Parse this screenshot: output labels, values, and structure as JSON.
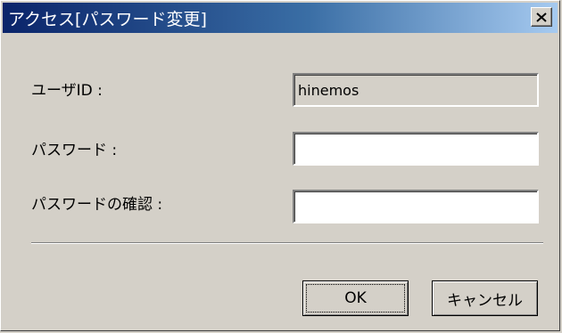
{
  "window": {
    "title": "アクセス[パスワード変更]",
    "close_icon": "close-icon"
  },
  "form": {
    "user_id_label": "ユーザID :",
    "user_id_value": "hinemos",
    "password_label": "パスワード :",
    "password_value": "",
    "password_confirm_label": "パスワードの確認 :",
    "password_confirm_value": ""
  },
  "buttons": {
    "ok_label": "OK",
    "cancel_label": "キャンセル"
  },
  "colors": {
    "title_start": "#0a246a",
    "title_end": "#a6caf0",
    "face": "#d4d0c8"
  }
}
